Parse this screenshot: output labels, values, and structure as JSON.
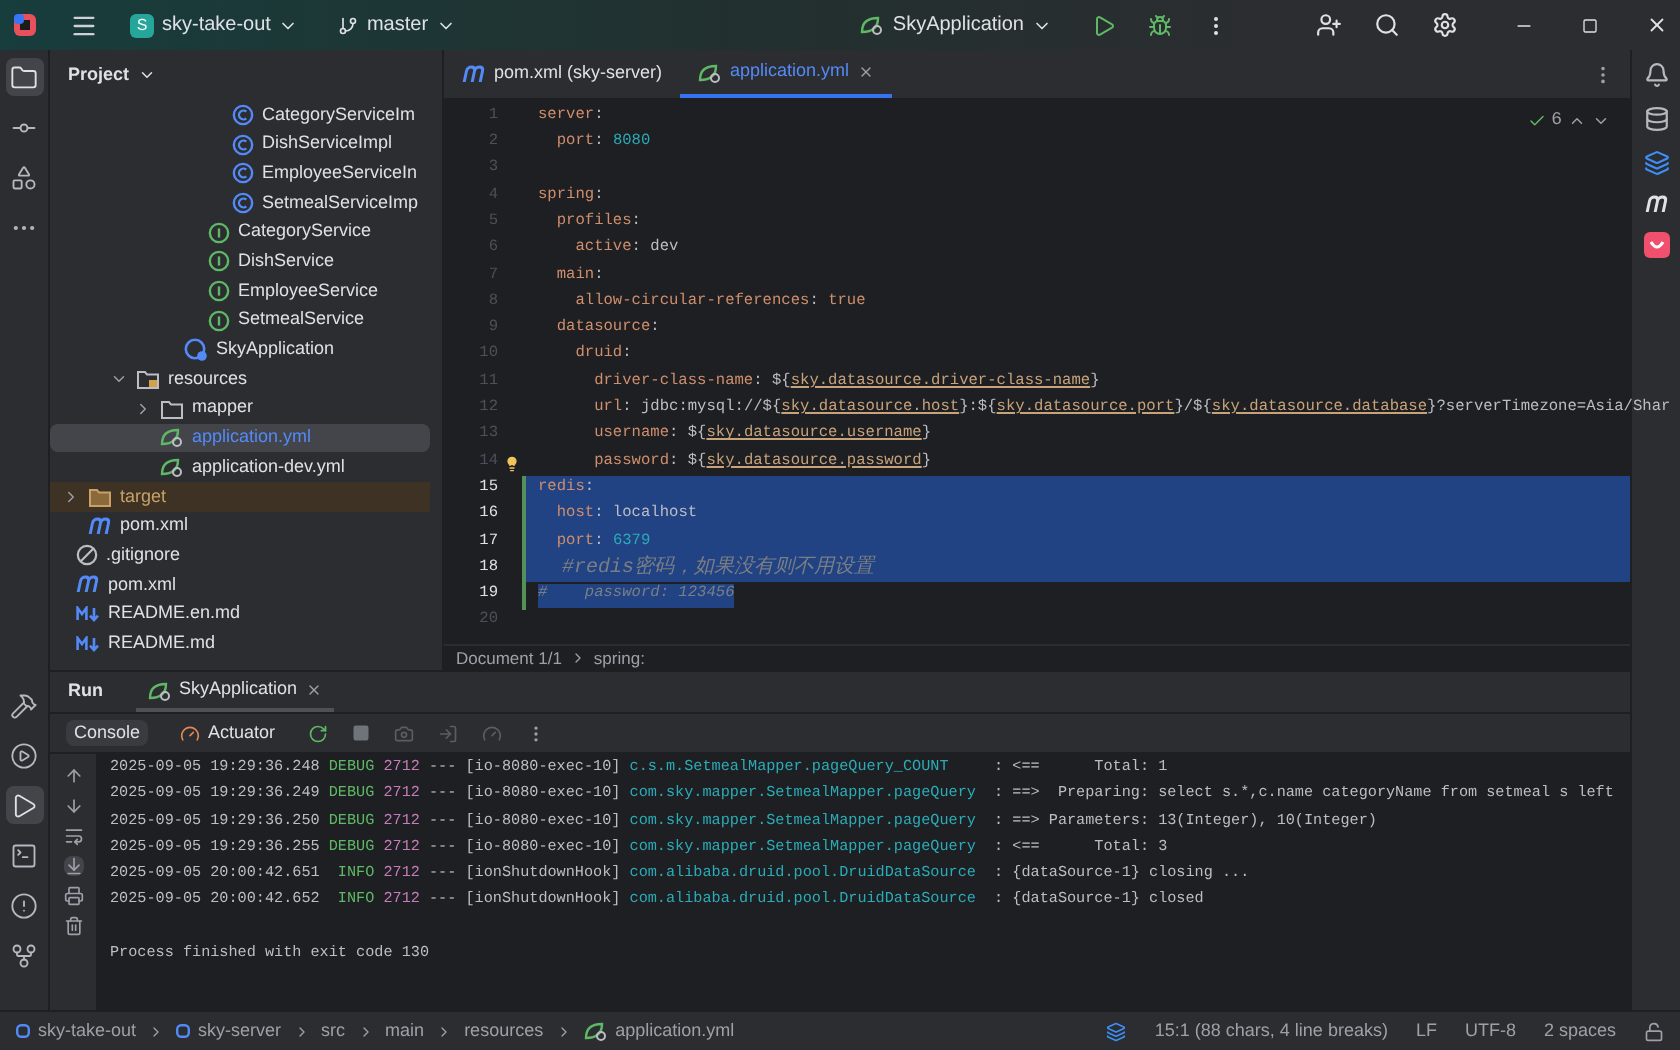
{
  "title_bar": {
    "project_badge": "S",
    "project": "sky-take-out",
    "branch": "master",
    "run_config": "SkyApplication"
  },
  "left_toolbar": {
    "top": [
      {
        "kind": "project",
        "selected": true
      },
      {
        "kind": "commit",
        "selected": false
      },
      {
        "kind": "structure",
        "selected": false
      },
      {
        "kind": "more",
        "selected": false
      }
    ],
    "bottom": [
      {
        "kind": "build",
        "selected": false
      },
      {
        "kind": "services",
        "selected": false
      },
      {
        "kind": "run",
        "selected": true
      },
      {
        "kind": "terminal",
        "selected": false
      },
      {
        "kind": "problems",
        "selected": false
      },
      {
        "kind": "git",
        "selected": false
      }
    ]
  },
  "project_panel": {
    "title": "Project",
    "tree": [
      {
        "children": [
          {
            "children": [
              {
                "children": [
                  {
                    "children": [
                      {
                        "children": [
                          {
                            "children": [
                              {
                                "children": [
                                  {
                                    "label": "CategoryServiceIm",
                                    "kind": "class",
                                    "selected": false
                                  },
                                  {
                                    "label": "DishServiceImpl",
                                    "kind": "class",
                                    "selected": false
                                  },
                                  {
                                    "label": "EmployeeServiceIn",
                                    "kind": "class",
                                    "selected": false
                                  },
                                  {
                                    "label": "SetmealServiceImp",
                                    "kind": "class",
                                    "selected": false
                                  }
                                ]
                              },
                              {
                                "label": "CategoryService",
                                "kind": "interface",
                                "selected": false
                              },
                              {
                                "label": "DishService",
                                "kind": "interface",
                                "selected": false
                              },
                              {
                                "label": "EmployeeService",
                                "kind": "interface",
                                "selected": false
                              },
                              {
                                "label": "SetmealService",
                                "kind": "interface",
                                "selected": false
                              }
                            ]
                          },
                          {
                            "label": "SkyApplication",
                            "kind": "app",
                            "selected": false
                          }
                        ]
                      }
                    ]
                  },
                  {
                    "label": "resources",
                    "kind": "resources",
                    "expanded": true,
                    "selected": false,
                    "children": [
                      {
                        "label": "mapper",
                        "kind": "folder",
                        "expanded": false,
                        "selected": false
                      },
                      {
                        "label": "application.yml",
                        "kind": "yaml",
                        "selected": true
                      },
                      {
                        "label": "application-dev.yml",
                        "kind": "yaml",
                        "selected": false
                      }
                    ]
                  }
                ]
              }
            ]
          },
          {
            "label": "target",
            "kind": "excluded",
            "expanded": false,
            "selected": false
          },
          {
            "label": "pom.xml",
            "kind": "maven",
            "selected": false
          }
        ]
      },
      {
        "label": ".gitignore",
        "kind": "ignore",
        "selected": false
      },
      {
        "label": "pom.xml",
        "kind": "maven",
        "selected": false
      },
      {
        "label": "README.en.md",
        "kind": "markdown",
        "selected": false
      },
      {
        "label": "README.md",
        "kind": "markdown",
        "selected": false
      }
    ]
  },
  "editor": {
    "tabs": [
      {
        "label": "pom.xml (sky-server)",
        "kind": "maven",
        "selected": false
      },
      {
        "label": "application.yml",
        "kind": "yaml",
        "selected": true
      }
    ],
    "inspections": "6",
    "lines": [
      {
        "n": "1",
        "selected": false,
        "changed": false,
        "bulb": false,
        "tokens": [
          {
            "text": "server",
            "kind": "key"
          },
          {
            "text": ":",
            "kind": "plain"
          }
        ]
      },
      {
        "n": "2",
        "selected": false,
        "changed": false,
        "bulb": false,
        "tokens": [
          {
            "text": "  port",
            "kind": "key"
          },
          {
            "text": ": ",
            "kind": "plain"
          },
          {
            "text": "8080",
            "kind": "number"
          }
        ]
      },
      {
        "n": "3",
        "selected": false,
        "changed": false,
        "bulb": false
      },
      {
        "n": "4",
        "selected": false,
        "changed": false,
        "bulb": false,
        "tokens": [
          {
            "text": "spring",
            "kind": "key"
          },
          {
            "text": ":",
            "kind": "plain"
          }
        ]
      },
      {
        "n": "5",
        "selected": false,
        "changed": false,
        "bulb": false,
        "tokens": [
          {
            "text": "  profiles",
            "kind": "key"
          },
          {
            "text": ":",
            "kind": "plain"
          }
        ]
      },
      {
        "n": "6",
        "selected": false,
        "changed": false,
        "bulb": false,
        "tokens": [
          {
            "text": "    active",
            "kind": "key"
          },
          {
            "text": ": dev",
            "kind": "plain"
          }
        ]
      },
      {
        "n": "7",
        "selected": false,
        "changed": false,
        "bulb": false,
        "tokens": [
          {
            "text": "  main",
            "kind": "key"
          },
          {
            "text": ":",
            "kind": "plain"
          }
        ]
      },
      {
        "n": "8",
        "selected": false,
        "changed": false,
        "bulb": false,
        "tokens": [
          {
            "text": "    allow-circular-references",
            "kind": "key"
          },
          {
            "text": ": ",
            "kind": "plain"
          },
          {
            "text": "true",
            "kind": "keyword"
          }
        ]
      },
      {
        "n": "9",
        "selected": false,
        "changed": false,
        "bulb": false,
        "tokens": [
          {
            "text": "  datasource",
            "kind": "key"
          },
          {
            "text": ":",
            "kind": "plain"
          }
        ]
      },
      {
        "n": "10",
        "selected": false,
        "changed": false,
        "bulb": false,
        "tokens": [
          {
            "text": "    druid",
            "kind": "key"
          },
          {
            "text": ":",
            "kind": "plain"
          }
        ]
      },
      {
        "n": "11",
        "selected": false,
        "changed": false,
        "bulb": false,
        "tokens": [
          {
            "text": "      driver-class-name",
            "kind": "key"
          },
          {
            "text": ": ${",
            "kind": "plain"
          },
          {
            "text": "sky.datasource.driver-class-name",
            "kind": "ref"
          },
          {
            "text": "}",
            "kind": "plain"
          }
        ]
      },
      {
        "n": "12",
        "selected": false,
        "changed": false,
        "bulb": false,
        "tokens": [
          {
            "text": "      url",
            "kind": "key"
          },
          {
            "text": ": jdbc:mysql://${",
            "kind": "plain"
          },
          {
            "text": "sky.datasource.host",
            "kind": "ref"
          },
          {
            "text": "}:${",
            "kind": "plain"
          },
          {
            "text": "sky.datasource.port",
            "kind": "ref"
          },
          {
            "text": "}/${",
            "kind": "plain"
          },
          {
            "text": "sky.datasource.database",
            "kind": "ref"
          },
          {
            "text": "}?serverTimezone=Asia/Shar",
            "kind": "plain"
          }
        ]
      },
      {
        "n": "13",
        "selected": false,
        "changed": false,
        "bulb": false,
        "tokens": [
          {
            "text": "      username",
            "kind": "key"
          },
          {
            "text": ": ${",
            "kind": "plain"
          },
          {
            "text": "sky.datasource.username",
            "kind": "ref"
          },
          {
            "text": "}",
            "kind": "plain"
          }
        ]
      },
      {
        "n": "14",
        "selected": false,
        "changed": false,
        "bulb": true,
        "tokens": [
          {
            "text": "      password",
            "kind": "key"
          },
          {
            "text": ": ${",
            "kind": "plain"
          },
          {
            "text": "sky.datasource.password",
            "kind": "ref"
          },
          {
            "text": "}",
            "kind": "plain"
          }
        ]
      },
      {
        "n": "15",
        "selected": true,
        "changed": true,
        "bulb": false,
        "tokens": [
          {
            "text": "redis",
            "kind": "key"
          },
          {
            "text": ":",
            "kind": "plain"
          }
        ]
      },
      {
        "n": "16",
        "selected": true,
        "changed": true,
        "bulb": false,
        "tokens": [
          {
            "text": "  host",
            "kind": "key"
          },
          {
            "text": ": localhost",
            "kind": "plain"
          }
        ]
      },
      {
        "n": "17",
        "selected": true,
        "changed": true,
        "bulb": false,
        "tokens": [
          {
            "text": "  port",
            "kind": "key"
          },
          {
            "text": ": ",
            "kind": "plain"
          },
          {
            "text": "6379",
            "kind": "number"
          }
        ]
      },
      {
        "n": "18",
        "selected": true,
        "changed": true,
        "bulb": false,
        "tokens": [
          {
            "text": "  #redis密码，如果没有则不用设置",
            "kind": "comment"
          }
        ]
      },
      {
        "n": "19",
        "selected": true,
        "changed": true,
        "bulb": false,
        "tokens": [
          {
            "text": "#    password: 123456",
            "kind": "comment"
          }
        ]
      },
      {
        "n": "20",
        "selected": false,
        "changed": false,
        "bulb": false
      }
    ],
    "breadcrumbs": [
      "Document 1/1",
      "spring:"
    ]
  },
  "run_panel": {
    "title": "Run",
    "tabs": [
      {
        "label": "SkyApplication",
        "selected": true
      }
    ],
    "views": [
      {
        "label": "Console",
        "kind": "console",
        "selected": true
      },
      {
        "label": "Actuator",
        "kind": "actuator",
        "selected": false
      }
    ],
    "log": [
      {
        "time": "2025-09-05 19:29:36.248",
        "level": "DEBUG",
        "pid": "2712",
        "sep": "---",
        "thread": "[io-8080-exec-10]",
        "logger": "c.s.m.SetmealMapper.pageQuery_COUNT",
        "message": ": <==      Total: 1"
      },
      {
        "time": "2025-09-05 19:29:36.249",
        "level": "DEBUG",
        "pid": "2712",
        "sep": "---",
        "thread": "[io-8080-exec-10]",
        "logger": "com.sky.mapper.SetmealMapper.pageQuery",
        "message": ": ==>  Preparing: select s.*,c.name categoryName from setmeal s left"
      },
      {
        "time": "2025-09-05 19:29:36.250",
        "level": "DEBUG",
        "pid": "2712",
        "sep": "---",
        "thread": "[io-8080-exec-10]",
        "logger": "com.sky.mapper.SetmealMapper.pageQuery",
        "message": ": ==> Parameters: 13(Integer), 10(Integer)"
      },
      {
        "time": "2025-09-05 19:29:36.255",
        "level": "DEBUG",
        "pid": "2712",
        "sep": "---",
        "thread": "[io-8080-exec-10]",
        "logger": "com.sky.mapper.SetmealMapper.pageQuery",
        "message": ": <==      Total: 3"
      },
      {
        "time": "2025-09-05 20:00:42.651",
        "level": "INFO",
        "pid": "2712",
        "sep": "---",
        "thread": "[ionShutdownHook]",
        "logger": "com.alibaba.druid.pool.DruidDataSource",
        "message": ": {dataSource-1} closing ..."
      },
      {
        "time": "2025-09-05 20:00:42.652",
        "level": "INFO",
        "pid": "2712",
        "sep": "---",
        "thread": "[ionShutdownHook]",
        "logger": "com.alibaba.druid.pool.DruidDataSource",
        "message": ": {dataSource-1} closed"
      }
    ],
    "exit_message": "Process finished with exit code 130"
  },
  "status_bar": {
    "path": [
      {
        "label": "sky-take-out",
        "kind": "module"
      },
      {
        "label": "sky-server",
        "kind": "module"
      },
      {
        "label": "src",
        "kind": "dir"
      },
      {
        "label": "main",
        "kind": "dir"
      },
      {
        "label": "resources",
        "kind": "dir"
      },
      {
        "label": "application.yml",
        "kind": "yaml"
      }
    ],
    "position": "15:1 (88 chars, 4 line breaks)",
    "line_ending": "LF",
    "encoding": "UTF-8",
    "indent": "2 spaces"
  }
}
